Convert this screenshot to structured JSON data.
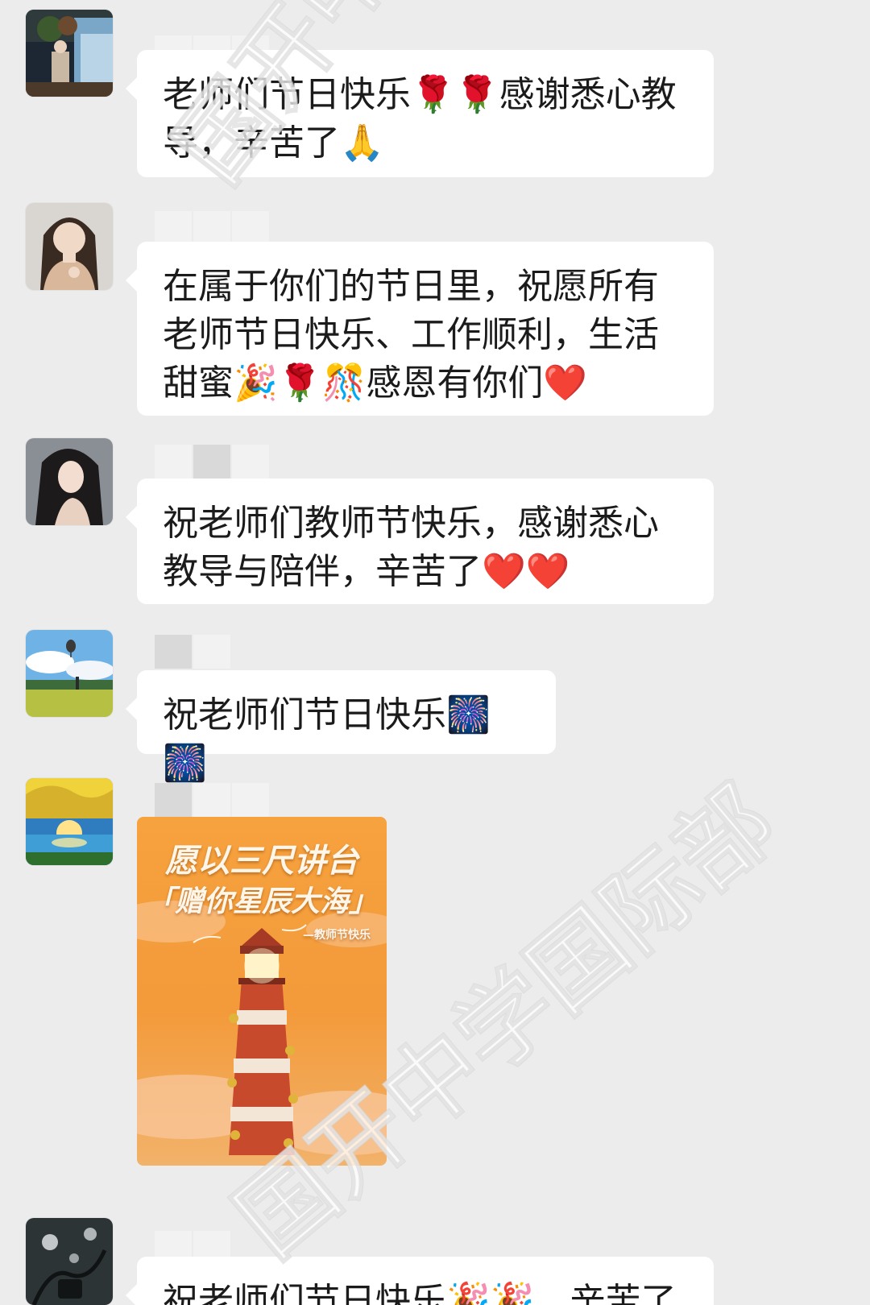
{
  "messages": [
    {
      "text": "老师们节日快乐🌹🌹感谢悉心教导，辛苦了🙏"
    },
    {
      "text": "在属于你们的节日里，祝愿所有老师节日快乐、工作顺利，生活甜蜜🎉🌹🎊感恩有你们❤️"
    },
    {
      "text": "祝老师们教师节快乐，感谢悉心教导与陪伴，辛苦了❤️❤️"
    },
    {
      "text": "祝老师们节日快乐🎆🎆"
    },
    {
      "poster": {
        "line1": "愿以三尺讲台",
        "line2": "「赠你星辰大海」",
        "small": "—教师节快乐"
      }
    },
    {
      "text": "祝老师们节日快乐🎉🎉，辛苦了"
    }
  ],
  "watermark": "国开中学国际部",
  "colors": {
    "background": "#ececec",
    "bubble": "#ffffff",
    "text": "#1b1b1b",
    "poster_orange": "#f59b3c"
  }
}
